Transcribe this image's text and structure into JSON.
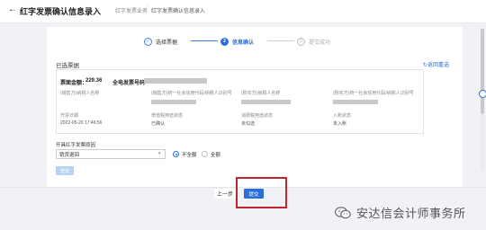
{
  "header": {
    "title": "红字发票确认信息录入",
    "breadcrumb": [
      "红字发票业务",
      "红字发票确认信息录入"
    ]
  },
  "steps": [
    {
      "index": "✓",
      "label": "选择票据",
      "state": "done"
    },
    {
      "index": "2",
      "label": "信息确认",
      "state": "active"
    },
    {
      "index": "3",
      "label": "提交成功",
      "state": "todo"
    }
  ],
  "section": {
    "title": "已选票据",
    "reselect": "返回重选"
  },
  "invoice": {
    "amount_label": "票面金额：",
    "amount": "229.36",
    "full_no_label": "全电发票号码",
    "fields": [
      {
        "label": "(销售方)纳税人名称",
        "value": ""
      },
      {
        "label": "(销售方)统一社会信用代码/纳税人识别号",
        "value": ""
      },
      {
        "label": "(购买方)纳税人名称",
        "value": ""
      },
      {
        "label": "(购买方)统一社会信用代码/纳税人识别号",
        "value": ""
      },
      {
        "label": "开票日期",
        "value": "2022-05-20 17:46:56"
      },
      {
        "label": "增值税用途状态",
        "value": "已确认"
      },
      {
        "label": "消费税用途状态",
        "value": "未勾选"
      },
      {
        "label": "入账状态",
        "value": "未入账"
      }
    ]
  },
  "reason": {
    "label": "开具红字发票原因",
    "selected": "销货退回",
    "options": [
      "不全额",
      "全额"
    ],
    "checked_option": "不全额"
  },
  "buttons": {
    "check": "查询",
    "prev": "上一步",
    "submit": "提交"
  },
  "watermark": "安达信会计师事务所",
  "colors": {
    "primary": "#2b6fd6",
    "highlight": "#c0262d"
  }
}
